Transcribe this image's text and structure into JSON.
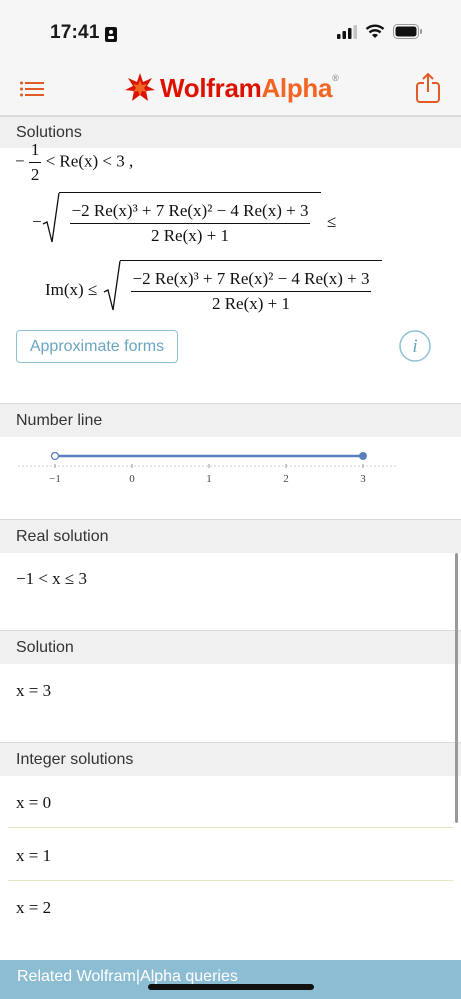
{
  "status_bar": {
    "time": "17:41"
  },
  "header": {
    "logo_main": "Wolfram",
    "logo_accent": "Alpha",
    "logo_mark": "®"
  },
  "sections": {
    "solutions": "Solutions",
    "number_line": "Number line",
    "real_solution": "Real solution",
    "solution": "Solution",
    "integer_solutions": "Integer solutions"
  },
  "solutions_math": {
    "line1_minus": "−",
    "line1_num": "1",
    "line1_den": "2",
    "line1_rest": "< Re(x) < 3 ,",
    "line2_minus": "−",
    "expr_num": "−2 Re(x)³ + 7 Re(x)² − 4 Re(x) + 3",
    "expr_den": "2 Re(x) + 1",
    "line2_rel": "≤",
    "line3_lhs": "Im(x) ≤"
  },
  "approx_button": "Approximate forms",
  "number_line": {
    "ticks": [
      "−1",
      "0",
      "1",
      "2",
      "3"
    ],
    "interval": {
      "from": -1,
      "to": 3,
      "from_closed": false,
      "to_closed": true
    },
    "color": "#5b7fbe"
  },
  "real_solution": "−1 < x ≤ 3",
  "solution": "x = 3",
  "integer_solutions": [
    "x = 0",
    "x = 1",
    "x = 2"
  ],
  "related_bar": "Related Wolfram|Alpha queries",
  "colors": {
    "brand_red": "#dd1100",
    "brand_orange": "#f26522",
    "section_bg": "#f0f0f0",
    "accent_blue": "#6aa6c0",
    "related_bg": "#8dbdd3"
  }
}
